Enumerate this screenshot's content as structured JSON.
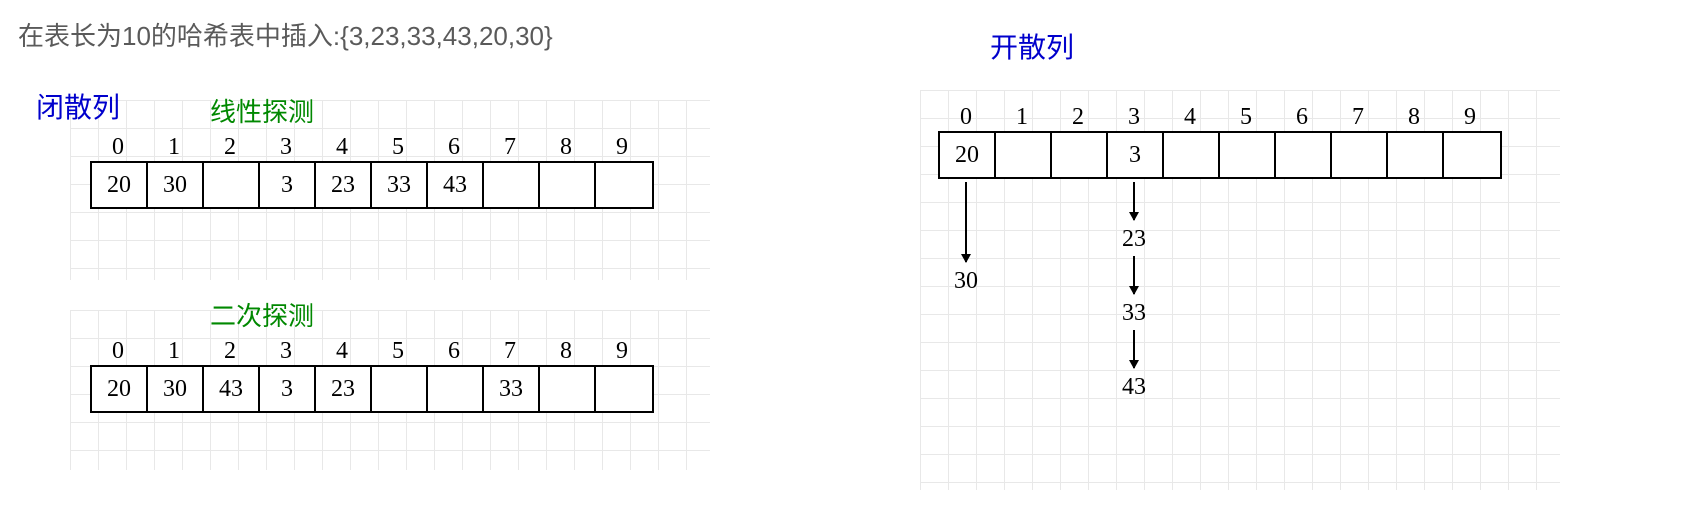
{
  "intro": "在表长为10的哈希表中插入:{3,23,33,43,20,30}",
  "closed_hashing_label": "闭散列",
  "open_hashing_label": "开散列",
  "linear_probe_label": "线性探测",
  "quadratic_probe_label": "二次探测",
  "indices": [
    "0",
    "1",
    "2",
    "3",
    "4",
    "5",
    "6",
    "7",
    "8",
    "9"
  ],
  "linear_cells": [
    "20",
    "30",
    "",
    "3",
    "23",
    "33",
    "43",
    "",
    "",
    ""
  ],
  "quadratic_cells": [
    "20",
    "30",
    "43",
    "3",
    "23",
    "",
    "",
    "33",
    "",
    ""
  ],
  "open_cells": [
    "20",
    "",
    "",
    "3",
    "",
    "",
    "",
    "",
    "",
    ""
  ],
  "chain0": [
    "30"
  ],
  "chain3": [
    "23",
    "33",
    "43"
  ],
  "chart_data": {
    "type": "table",
    "title": "Hash table collision resolution: closed (linear/quadratic) vs open (chaining)",
    "table_size": 10,
    "insert_sequence": [
      3,
      23,
      33,
      43,
      20,
      30
    ],
    "closed_linear": {
      "0": 20,
      "1": 30,
      "3": 3,
      "4": 23,
      "5": 33,
      "6": 43
    },
    "closed_quadratic": {
      "0": 20,
      "1": 30,
      "2": 43,
      "3": 3,
      "4": 23,
      "7": 33
    },
    "open_chaining": {
      "0": [
        20,
        30
      ],
      "3": [
        3,
        23,
        33,
        43
      ]
    }
  }
}
